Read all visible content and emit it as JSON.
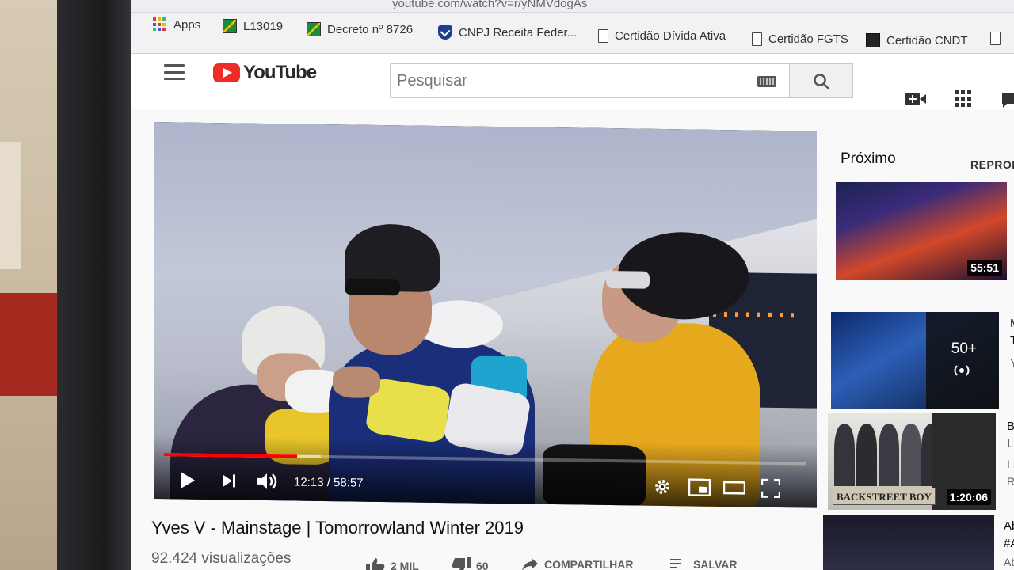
{
  "browser": {
    "url": "youtube.com/watch?v=r/yNMVdogAs",
    "bookmarks": [
      {
        "label": "Apps",
        "icon": "apps-grid-icon"
      },
      {
        "label": "L13019",
        "icon": "flag-icon"
      },
      {
        "label": "Decreto nº 8726",
        "icon": "flag-icon"
      },
      {
        "label": "CNPJ Receita Feder...",
        "icon": "shield-icon"
      },
      {
        "label": "Certidão Dívida Ativa",
        "icon": "page-icon"
      },
      {
        "label": "Certidão FGTS",
        "icon": "page-icon"
      },
      {
        "label": "Certidão CNDT",
        "icon": "dark-page-icon"
      }
    ]
  },
  "header": {
    "logo_text": "YouTube",
    "search_placeholder": "Pesquisar"
  },
  "player": {
    "current_time": "12:13",
    "duration": "58:57",
    "time_display": "12:13 / 58:57",
    "progress_fraction": 0.207,
    "buffered_fraction": 0.245,
    "accent_color": "#ff0000"
  },
  "video": {
    "title": "Yves V - Mainstage | Tomorrowland Winter 2019",
    "views": "92.424 visualizações",
    "likes": "2 MIL",
    "dislikes": "60",
    "share_label": "COMPARTILHAR",
    "save_label": "SALVAR"
  },
  "sidebar": {
    "up_next_label": "Próximo",
    "autoplay_label": "REPRODUÇÃO",
    "items": [
      {
        "duration": "55:51",
        "title": "",
        "channel": ""
      },
      {
        "playlist_count": "50+",
        "title": "M",
        "line2": "T",
        "channel": "Y"
      },
      {
        "duration": "1:20:06",
        "banner": "BACKSTREET BOY",
        "title": "Ba",
        "line2": "Lo",
        "line3": "I L",
        "channel": "Re"
      },
      {
        "title": "Ab",
        "line2": "#A",
        "channel": "Ab"
      }
    ]
  }
}
